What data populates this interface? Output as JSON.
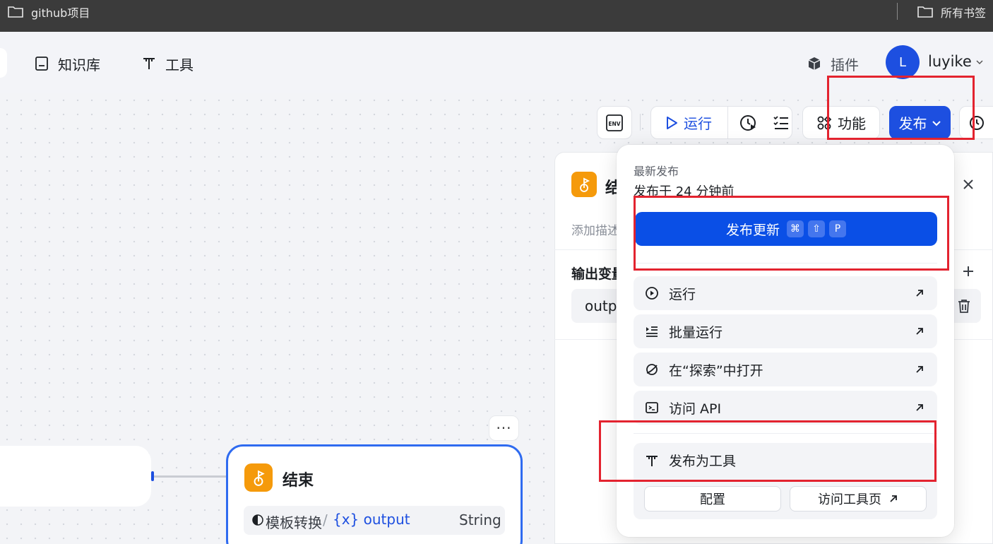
{
  "bookmarks": {
    "left_folder": "github项目",
    "right_folder": "所有书签"
  },
  "topnav": {
    "knowledge_base": "知识库",
    "tools": "工具",
    "plugins": "插件",
    "avatar_letter": "L",
    "username": "luyike"
  },
  "toolbar": {
    "env_label": "ENV",
    "run_label": "运行",
    "feature_label": "功能",
    "publish_label": "发布"
  },
  "side_panel": {
    "title": "结",
    "description": "添加描述",
    "output_heading": "输出变量",
    "output_field": "outp"
  },
  "end_node": {
    "title": "结束",
    "source_node": "模板转换",
    "slash": "/",
    "variable": "{x} output",
    "type": "String",
    "more": "···"
  },
  "publish_menu": {
    "latest_label": "最新发布",
    "published_time": "发布于 24 分钟前",
    "primary_button": "发布更新",
    "shortcut_keys": [
      "⌘",
      "⇧",
      "P"
    ],
    "items": [
      {
        "label": "运行",
        "icon": "play-circle-icon"
      },
      {
        "label": "批量运行",
        "icon": "batch-run-icon"
      },
      {
        "label": "在“探索”中打开",
        "icon": "explore-icon"
      },
      {
        "label": "访问 API",
        "icon": "terminal-icon"
      }
    ],
    "publish_as_tool": "发布为工具",
    "config_button": "配置",
    "visit_tool_button": "访问工具页"
  },
  "colors": {
    "primary": "#1d4fe0",
    "highlight": "#e3232f",
    "node_icon": "#f59a0b"
  }
}
